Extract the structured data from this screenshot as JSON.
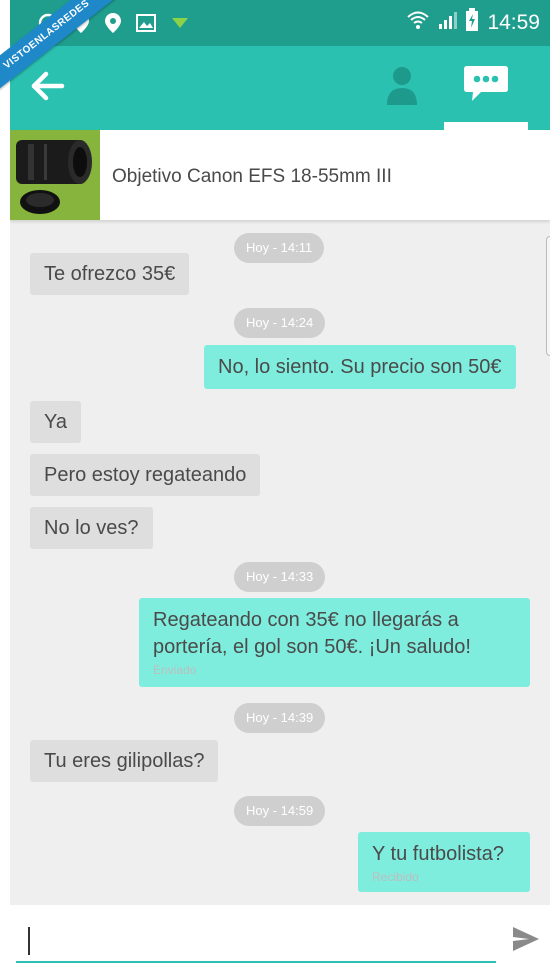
{
  "watermark": "VISTOENLASREDES",
  "status_bar": {
    "time": "14:59",
    "icons": [
      "whatsapp-icon",
      "location-icon",
      "location-icon",
      "image-icon",
      "download-icon",
      "wifi-icon",
      "signal-icon",
      "battery-charging-icon"
    ]
  },
  "header": {
    "back_icon": "arrow-left-icon",
    "profile_icon": "user-icon",
    "chat_icon": "chat-bubble-icon"
  },
  "product": {
    "title": "Objetivo Canon EFS 18-55mm III",
    "image": "camera-lens-photo"
  },
  "messages": [
    {
      "kind": "time",
      "text": "Hoy - 14:11"
    },
    {
      "kind": "in",
      "text": "Te ofrezco 35€"
    },
    {
      "kind": "time",
      "text": "Hoy - 14:24"
    },
    {
      "kind": "out",
      "text": "No, lo siento. Su precio son 50€"
    },
    {
      "kind": "in",
      "text": "Ya"
    },
    {
      "kind": "in",
      "text": "Pero estoy regateando"
    },
    {
      "kind": "in",
      "text": "No lo ves?"
    },
    {
      "kind": "time",
      "text": "Hoy - 14:33"
    },
    {
      "kind": "out",
      "line1": "Regateando con 35€ no llegarás a",
      "line2": "portería, el gol son 50€. ¡Un saludo!",
      "status": "Enviado"
    },
    {
      "kind": "time",
      "text": "Hoy - 14:39"
    },
    {
      "kind": "in",
      "text": "Tu eres gilipollas?"
    },
    {
      "kind": "time",
      "text": "Hoy - 14:59"
    },
    {
      "kind": "out",
      "text": "Y tu futbolista?",
      "status": "Recibido"
    }
  ],
  "composer": {
    "value": "",
    "send_icon": "send-icon"
  },
  "colors": {
    "status_bar": "#1f9e8e",
    "app_bar": "#2ac1b0",
    "outgoing_bubble": "#7fedde",
    "incoming_bubble": "#dedede",
    "timestamp_pill": "#cfcfcf"
  }
}
